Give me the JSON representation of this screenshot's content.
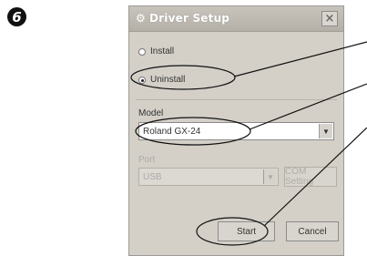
{
  "step": {
    "badge": "6"
  },
  "dialog": {
    "title": "Driver Setup",
    "title_icon": "setup-icon",
    "close": "×",
    "install_label": "Install",
    "uninstall_label": "Uninstall",
    "selected_action": "Uninstall",
    "model_label": "Model",
    "model_value": "Roland GX-24",
    "port_label": "Port",
    "port_value": "USB",
    "com_setting_label": "COM Setting",
    "start_label": "Start",
    "cancel_label": "Cancel",
    "dropdown_arrow": "▼"
  }
}
